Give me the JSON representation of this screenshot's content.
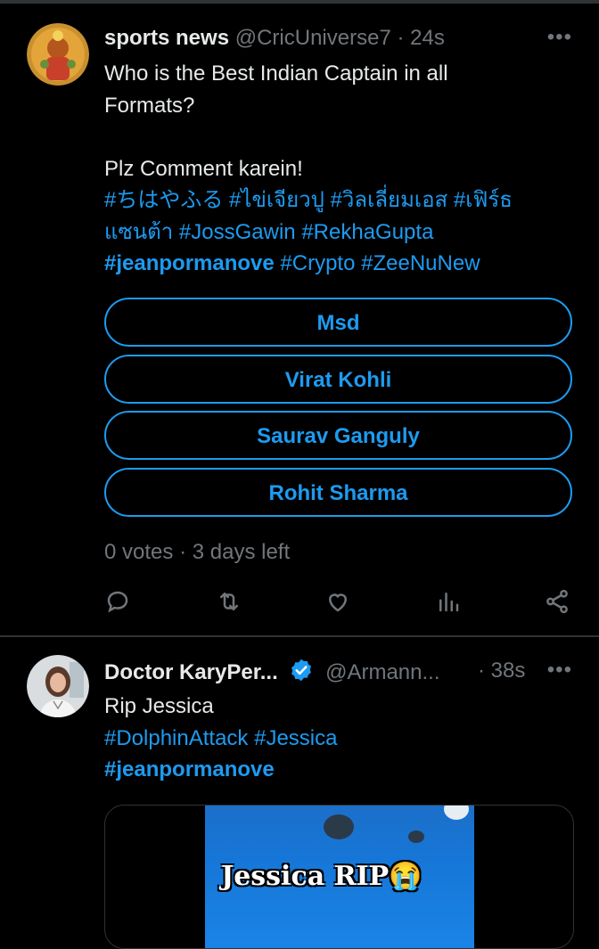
{
  "colors": {
    "accent": "#1d9bf0",
    "muted": "#71767b",
    "text": "#e7e9ea",
    "background": "#000000"
  },
  "tweet1": {
    "display_name": "sports news",
    "handle": "@CricUniverse7",
    "separator": "·",
    "time": "24s",
    "more_icon": "more-horizontal-icon",
    "text_line1": "Who is the Best Indian Captain in all",
    "text_line2": "Formats?",
    "text_line3": "Plz Comment karein!",
    "hashtags": {
      "h1": "#ちはやふる",
      "h2": "#ไข่เจียวปู",
      "h3": "#วิลเลี่ยมเอส",
      "h4": "#เฟิร์ธ",
      "h4b": "แซนต้า",
      "h5": "#JossGawin",
      "h6": "#RekhaGupta",
      "h7": "#jeanpormanove",
      "h8": "#Crypto",
      "h9": "#ZeeNuNew"
    },
    "poll_options": [
      "Msd",
      "Virat Kohli",
      "Saurav Ganguly",
      "Rohit Sharma"
    ],
    "votes": "0 votes",
    "dot": "·",
    "time_left": "3 days left",
    "actions": [
      "reply-icon",
      "retweet-icon",
      "like-icon",
      "views-icon",
      "share-icon"
    ]
  },
  "tweet2": {
    "display_name": "Doctor KaryPer...",
    "handle": "@Armann...",
    "time": "· 38s",
    "more_icon": "more-horizontal-icon",
    "text_line1": "Rip Jessica",
    "tag1": "#DolphinAttack",
    "tag2": "#Jessica",
    "tag3": "#jeanpormanove",
    "media_caption": "Jessica RIP😭",
    "verified_icon": "verified-badge-icon"
  }
}
